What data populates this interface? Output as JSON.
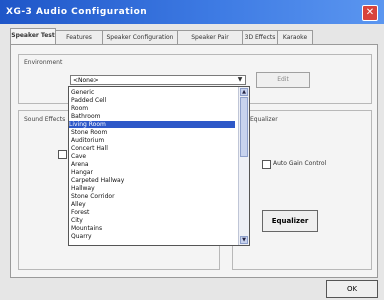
{
  "window": {
    "title": "XG-3 Audio Configuration",
    "close_glyph": "✕"
  },
  "tabs": [
    "Speaker Test",
    "Features",
    "Speaker Configuration",
    "Speaker Pair",
    "3D Effects",
    "Karaoke"
  ],
  "environment": {
    "group_label": "Environment",
    "selected": "<None>",
    "button_label": "Edit"
  },
  "side_group_label": "Sound Effects",
  "environment_list": {
    "items": [
      "Generic",
      "Padded Cell",
      "Room",
      "Bathroom",
      "Living Room",
      "Stone Room",
      "Auditorium",
      "Concert Hall",
      "Cave",
      "Arena",
      "Hangar",
      "Carpeted Hallway",
      "Hallway",
      "Stone Corridor",
      "Alley",
      "Forest",
      "City",
      "Mountains",
      "Quarry"
    ],
    "selected_index": 4
  },
  "right_group_label": "Equalizer",
  "auto_gain": {
    "label": "Auto Gain Control"
  },
  "equalizer_button": "Equalizer",
  "ok_button": "OK"
}
